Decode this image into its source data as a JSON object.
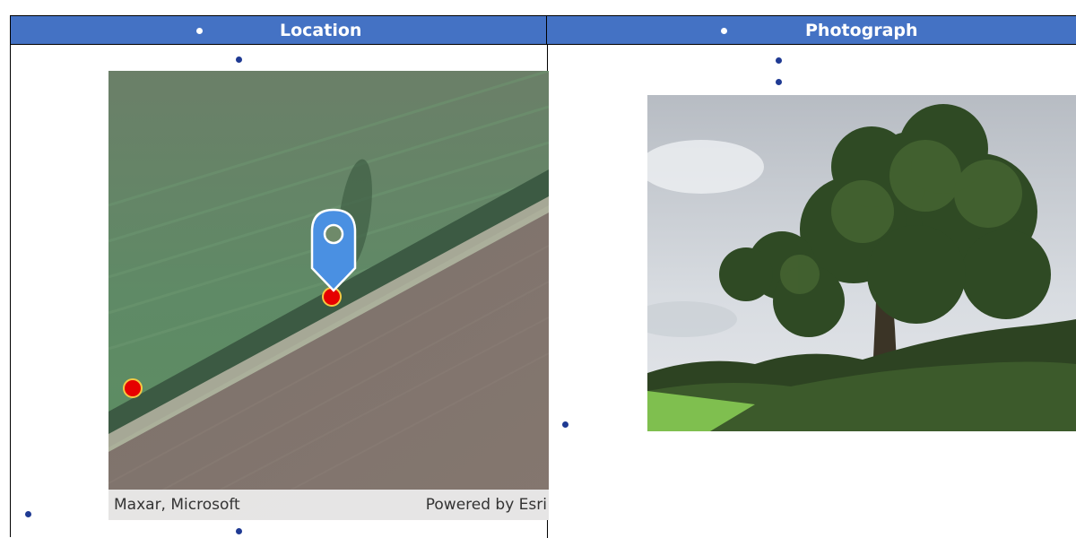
{
  "table": {
    "columns": [
      {
        "label": "Location"
      },
      {
        "label": "Photograph"
      }
    ]
  },
  "map": {
    "attribution_left": "Maxar, Microsoft",
    "attribution_right": "Powered by Esri",
    "marker_color": "#4a90e2",
    "point_color": "#e60000"
  },
  "colors": {
    "header_bg": "#4472c4",
    "header_text": "#ffffff",
    "bullet": "#1f3a93"
  }
}
